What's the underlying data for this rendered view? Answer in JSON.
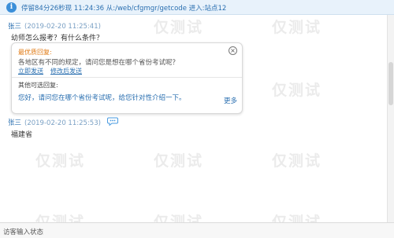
{
  "top_bar": {
    "status_text": "停留84分26秒现 11:24:36 从:/web/cfgmgr/getcode  进入:站点12"
  },
  "messages": [
    {
      "sender": "张三",
      "time": "(2019-02-20 11:25:41)",
      "text": "幼师怎么报考？有什么条件？"
    },
    {
      "sender": "张三",
      "time": "(2019-02-20 11:25:53)",
      "text": "福建省"
    }
  ],
  "suggestion": {
    "best_label": "最优质回复:",
    "best_text": "各地区有不同的规定，请问您是想在哪个省份考试呢？",
    "send_now": "立即发送",
    "edit_send": "修改后发送",
    "other_label": "其他可选回复:",
    "other_text": "您好，请问您在哪个省份考试呢，给您针对性介绍一下。",
    "more": "更多"
  },
  "footer": {
    "label": "访客输入状态"
  },
  "watermark": "仅测试",
  "colors": {
    "accent": "#2a6fb0",
    "best_label": "#e07a14",
    "top_bar_bg": "#e8f2fb"
  },
  "icons": {
    "top_bar": "info-icon",
    "suggest_close": "close-icon",
    "message": "chat-bubble-icon"
  }
}
